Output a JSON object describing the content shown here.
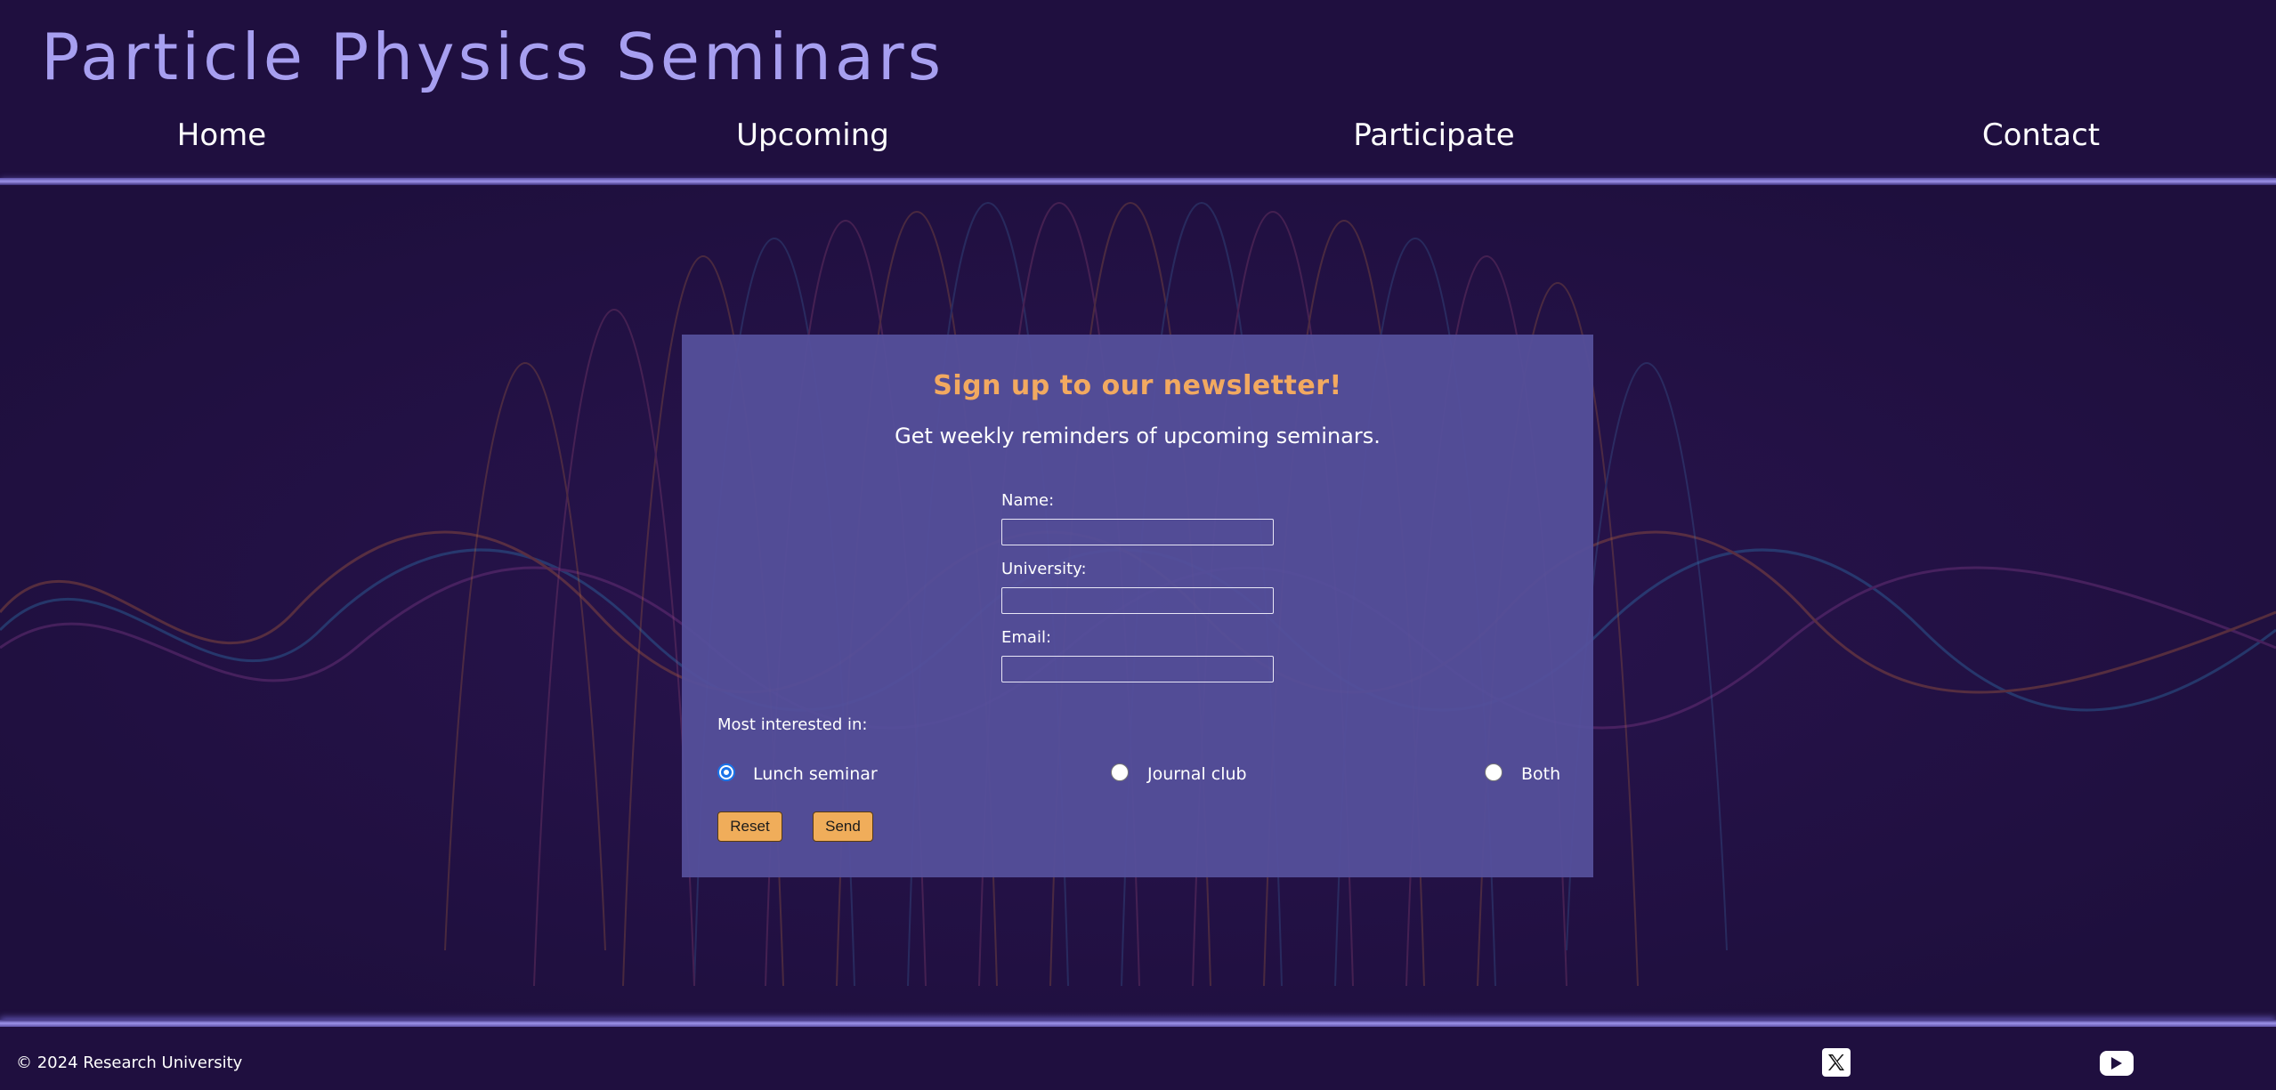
{
  "header": {
    "title": "Particle Physics Seminars",
    "nav": [
      {
        "label": "Home"
      },
      {
        "label": "Upcoming"
      },
      {
        "label": "Participate"
      },
      {
        "label": "Contact"
      }
    ]
  },
  "newsletter": {
    "title": "Sign up to our newsletter!",
    "subtitle": "Get weekly reminders of upcoming seminars.",
    "fields": [
      {
        "label": "Name:",
        "value": ""
      },
      {
        "label": "University:",
        "value": ""
      },
      {
        "label": "Email:",
        "value": ""
      }
    ],
    "interest_label": "Most interested in:",
    "options": [
      {
        "label": "Lunch seminar",
        "checked": true
      },
      {
        "label": "Journal club",
        "checked": false
      },
      {
        "label": "Both",
        "checked": false
      }
    ],
    "reset_label": "Reset",
    "send_label": "Send"
  },
  "footer": {
    "copyright": "© 2024 Research University",
    "social": [
      {
        "icon": "x-logo-icon"
      },
      {
        "icon": "youtube-icon"
      }
    ]
  },
  "colors": {
    "background": "#1e0f3d",
    "title": "#a79ff0",
    "panel": "#55509b",
    "accent": "#f2a960",
    "button": "#f0ad5a"
  }
}
